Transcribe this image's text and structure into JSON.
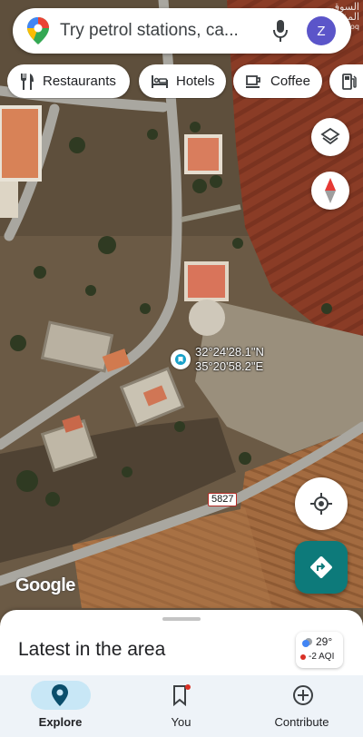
{
  "watermark": {
    "text": "السوق المفتوح",
    "subtext": "opensooq"
  },
  "search": {
    "placeholder": "Try petrol stations, ca...",
    "account_initial": "Z"
  },
  "chips": [
    {
      "label": "Restaurants",
      "icon": "fork-knife-icon"
    },
    {
      "label": "Hotels",
      "icon": "bed-icon"
    },
    {
      "label": "Coffee",
      "icon": "coffee-cup-icon"
    },
    {
      "label": "",
      "icon": "fuel-pump-icon"
    }
  ],
  "map": {
    "coordinates": {
      "lat": "32°24'28.1\"N",
      "lng": "35°20'58.2\"E"
    },
    "road_label": "5827",
    "attribution": "Google",
    "buttons": [
      "layers-icon",
      "compass-icon",
      "my-location-icon",
      "directions-icon"
    ]
  },
  "sheet": {
    "title": "Latest in the area",
    "weather": {
      "temp": "29°",
      "aqi": "-2 AQI"
    }
  },
  "nav": {
    "items": [
      {
        "label": "Explore",
        "icon": "explore-pin-icon",
        "active": true
      },
      {
        "label": "You",
        "icon": "bookmark-icon",
        "active": false
      },
      {
        "label": "Contribute",
        "icon": "add-circle-icon",
        "active": false
      }
    ]
  },
  "colors": {
    "accent": "#0d7a7a",
    "nav_active": "#c8e7f6",
    "badge": "#d93025",
    "avatar": "#5b55c9"
  }
}
